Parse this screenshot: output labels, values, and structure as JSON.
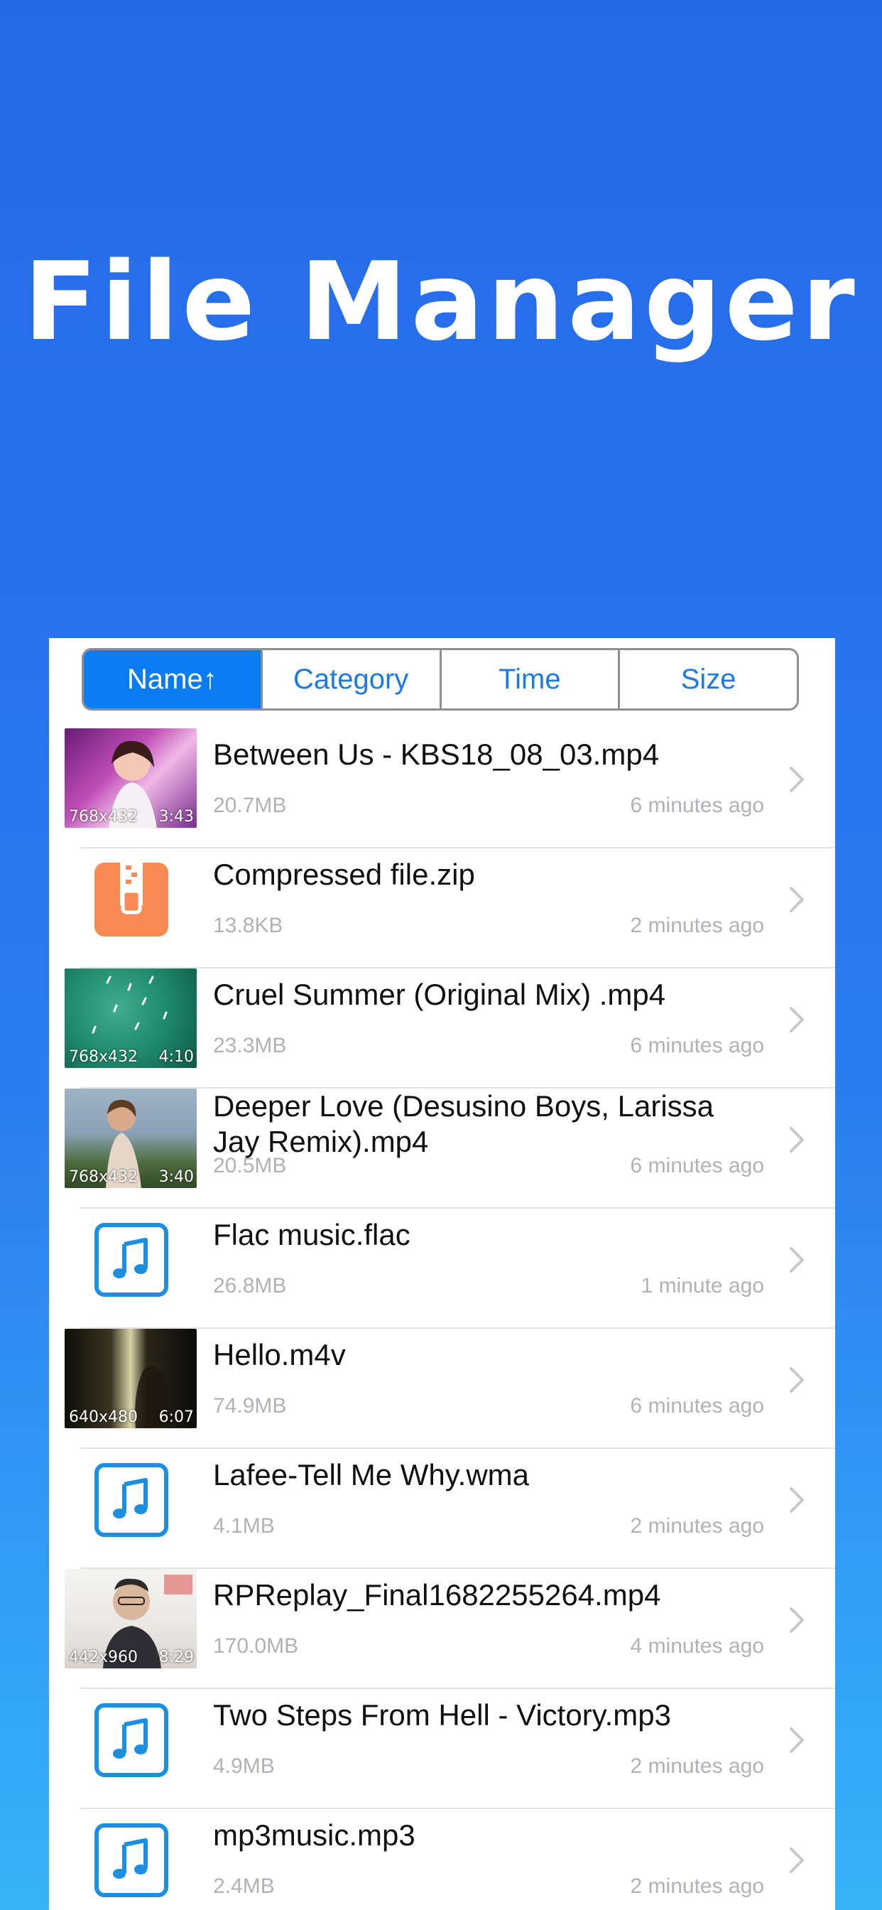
{
  "hero": {
    "title": "File Manager"
  },
  "sort_tabs": [
    {
      "label": "Name↑",
      "active": true
    },
    {
      "label": "Category",
      "active": false
    },
    {
      "label": "Time",
      "active": false
    },
    {
      "label": "Size",
      "active": false
    }
  ],
  "files": [
    {
      "name": "Between Us - KBS18_08_03.mp4",
      "size": "20.7MB",
      "time": "6 minutes ago",
      "kind": "video",
      "dims": "768x432",
      "duration": "3:43"
    },
    {
      "name": "Compressed file.zip",
      "size": "13.8KB",
      "time": "2 minutes ago",
      "kind": "zip"
    },
    {
      "name": "Cruel Summer (Original Mix) .mp4",
      "size": "23.3MB",
      "time": "6 minutes ago",
      "kind": "video",
      "dims": "768x432",
      "duration": "4:10"
    },
    {
      "name": "Deeper Love (Desusino Boys, Larissa Jay Remix).mp4",
      "size": "20.5MB",
      "time": "6 minutes ago",
      "kind": "video",
      "dims": "768x432",
      "duration": "3:40"
    },
    {
      "name": "Flac music.flac",
      "size": "26.8MB",
      "time": "1 minute ago",
      "kind": "audio"
    },
    {
      "name": "Hello.m4v",
      "size": "74.9MB",
      "time": "6 minutes ago",
      "kind": "video",
      "dims": "640x480",
      "duration": "6:07"
    },
    {
      "name": "Lafee-Tell Me Why.wma",
      "size": "4.1MB",
      "time": "2 minutes ago",
      "kind": "audio"
    },
    {
      "name": "RPReplay_Final1682255264.mp4",
      "size": "170.0MB",
      "time": "4 minutes ago",
      "kind": "video",
      "dims": "442x960",
      "duration": "8:29"
    },
    {
      "name": "Two Steps From Hell - Victory.mp3",
      "size": "4.9MB",
      "time": "2 minutes ago",
      "kind": "audio"
    },
    {
      "name": "mp3music.mp3",
      "size": "2.4MB",
      "time": "2 minutes ago",
      "kind": "audio"
    }
  ],
  "colors": {
    "accent": "#0a7cf3",
    "music_icon": "#1d8fe0",
    "zip_icon": "#f88b54"
  },
  "icons": {
    "video": "video-thumbnail",
    "audio": "music-note-icon",
    "zip": "zip-file-icon",
    "chevron": "chevron-right-icon"
  }
}
